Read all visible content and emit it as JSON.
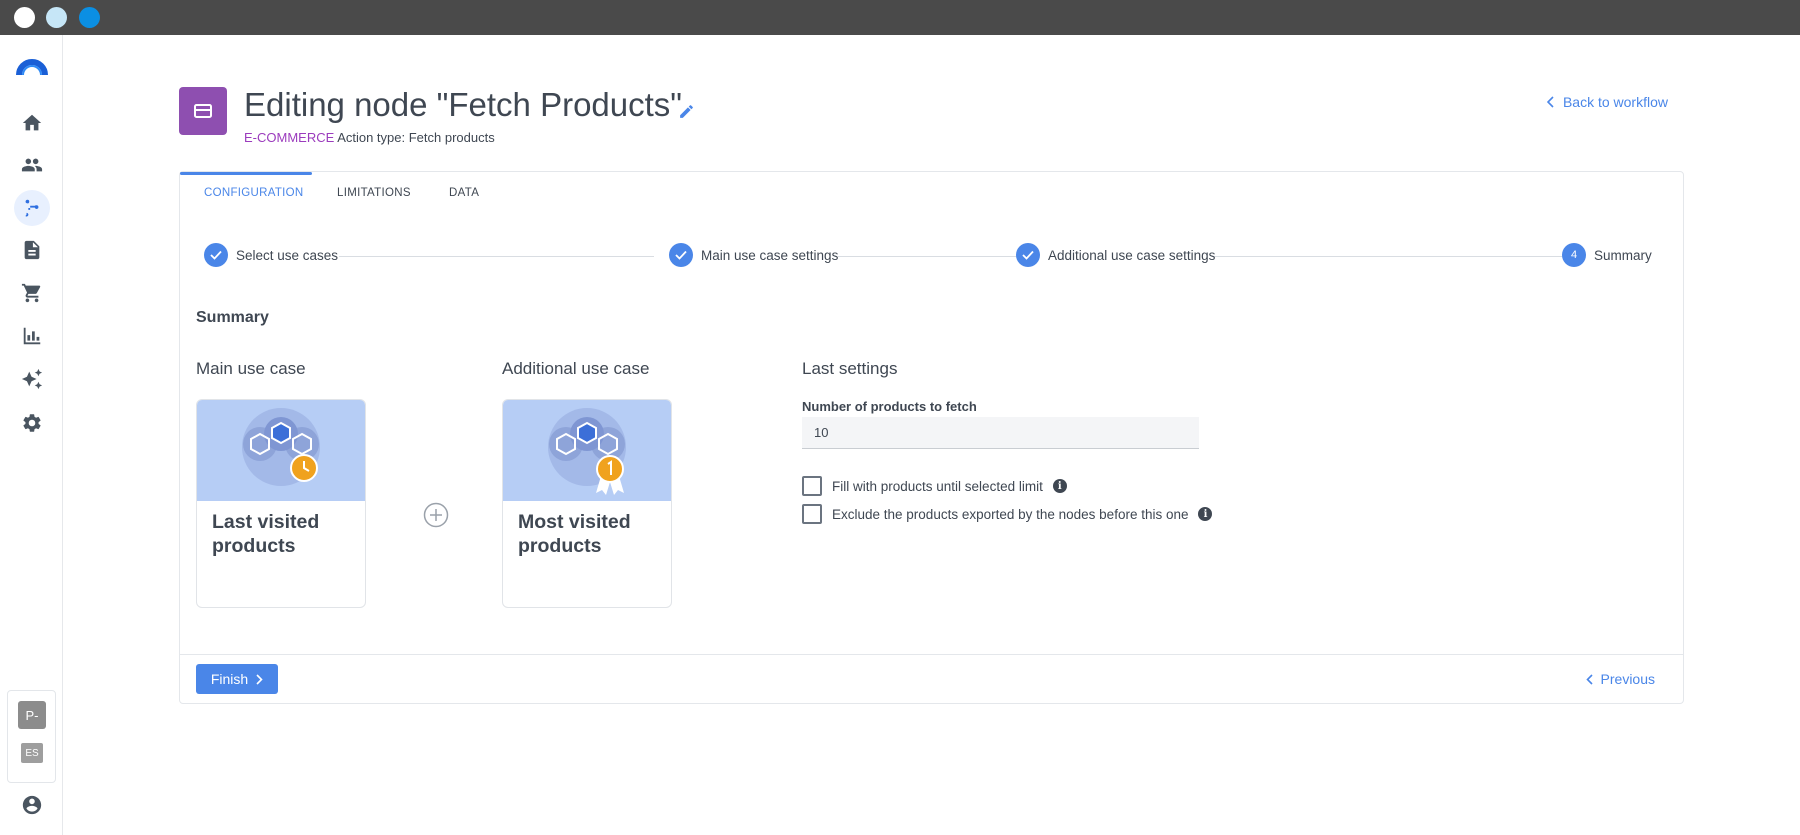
{
  "window": {
    "dots": [
      "close",
      "minimize",
      "maximize"
    ]
  },
  "sidebar": {
    "items": [
      {
        "icon": "home-icon"
      },
      {
        "icon": "people-icon"
      },
      {
        "icon": "workflow-icon",
        "active": true
      },
      {
        "icon": "document-icon"
      },
      {
        "icon": "cart-icon"
      },
      {
        "icon": "bar-chart-icon"
      },
      {
        "icon": "sparkle-icon"
      },
      {
        "icon": "gear-icon"
      }
    ],
    "user_initial": "P-",
    "language": "ES",
    "account_icon": "account-circle-icon"
  },
  "header": {
    "title": "Editing node \"Fetch Products\"",
    "category": "E-COMMERCE",
    "action_type": "Action type: Fetch products",
    "back_link": "Back to workflow"
  },
  "tabs": [
    {
      "label": "CONFIGURATION",
      "active": true
    },
    {
      "label": "LIMITATIONS",
      "active": false
    },
    {
      "label": "DATA",
      "active": false
    }
  ],
  "stepper": [
    {
      "label": "Select use cases",
      "state": "done"
    },
    {
      "label": "Main use case settings",
      "state": "done"
    },
    {
      "label": "Additional use case settings",
      "state": "done"
    },
    {
      "label": "Summary",
      "state": "current",
      "number": "4"
    }
  ],
  "summary": {
    "title": "Summary",
    "main_use_case": {
      "heading": "Main use case",
      "card_label": "Last visited products"
    },
    "additional_use_case": {
      "heading": "Additional use case",
      "card_label": "Most visited products"
    },
    "last_settings": {
      "heading": "Last settings",
      "products_label": "Number of products to fetch",
      "products_value": "10",
      "fill_label": "Fill with products until selected limit",
      "exclude_label": "Exclude the products exported by the nodes before this one"
    }
  },
  "footer": {
    "finish_label": "Finish",
    "previous_label": "Previous"
  },
  "colors": {
    "accent": "#4a86e8",
    "node": "#8e4fb0",
    "category": "#9b3bbd"
  }
}
